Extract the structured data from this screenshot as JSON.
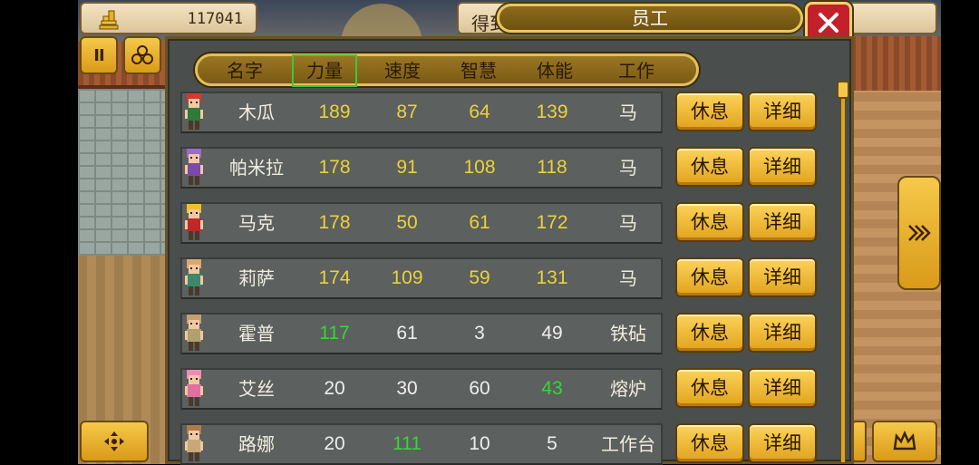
{
  "header": {
    "coins": "117041",
    "peek_label": "得到",
    "title": "员工"
  },
  "columns": {
    "name": "名字",
    "strength": "力量",
    "speed": "速度",
    "wisdom": "智慧",
    "stamina": "体能",
    "job": "工作"
  },
  "selected_column": "strength",
  "buttons": {
    "pause": "II",
    "rest": "休息",
    "detail": "详细"
  },
  "workers": [
    {
      "name": "木瓜",
      "strength": "189",
      "speed": "87",
      "wisdom": "64",
      "stamina": "139",
      "job": "马",
      "colors": [
        "yellow",
        "yellow",
        "yellow",
        "yellow"
      ],
      "hair": "#d23a2a",
      "body": "#2e7a3a"
    },
    {
      "name": "帕米拉",
      "strength": "178",
      "speed": "91",
      "wisdom": "108",
      "stamina": "118",
      "job": "马",
      "colors": [
        "yellow",
        "yellow",
        "yellow",
        "yellow"
      ],
      "hair": "#9a6ad0",
      "body": "#7a4aa8"
    },
    {
      "name": "马克",
      "strength": "178",
      "speed": "50",
      "wisdom": "61",
      "stamina": "172",
      "job": "马",
      "colors": [
        "yellow",
        "yellow",
        "yellow",
        "yellow"
      ],
      "hair": "#f0c02a",
      "body": "#c02828"
    },
    {
      "name": "莉萨",
      "strength": "174",
      "speed": "109",
      "wisdom": "59",
      "stamina": "131",
      "job": "马",
      "colors": [
        "yellow",
        "yellow",
        "yellow",
        "yellow"
      ],
      "hair": "#d9a870",
      "body": "#3a8a6a"
    },
    {
      "name": "霍普",
      "strength": "117",
      "speed": "61",
      "wisdom": "3",
      "stamina": "49",
      "job": "铁砧",
      "colors": [
        "green",
        "white",
        "white",
        "white"
      ],
      "hair": "#c8a070",
      "body": "#b0a070"
    },
    {
      "name": "艾丝",
      "strength": "20",
      "speed": "30",
      "wisdom": "60",
      "stamina": "43",
      "job": "熔炉",
      "colors": [
        "white",
        "white",
        "white",
        "green"
      ],
      "hair": "#f08ab8",
      "body": "#e070a0"
    },
    {
      "name": "路娜",
      "strength": "20",
      "speed": "111",
      "wisdom": "10",
      "stamina": "5",
      "job": "工作台",
      "colors": [
        "white",
        "green",
        "white",
        "white"
      ],
      "hair": "#b07a4a",
      "body": "#c8a878"
    }
  ]
}
